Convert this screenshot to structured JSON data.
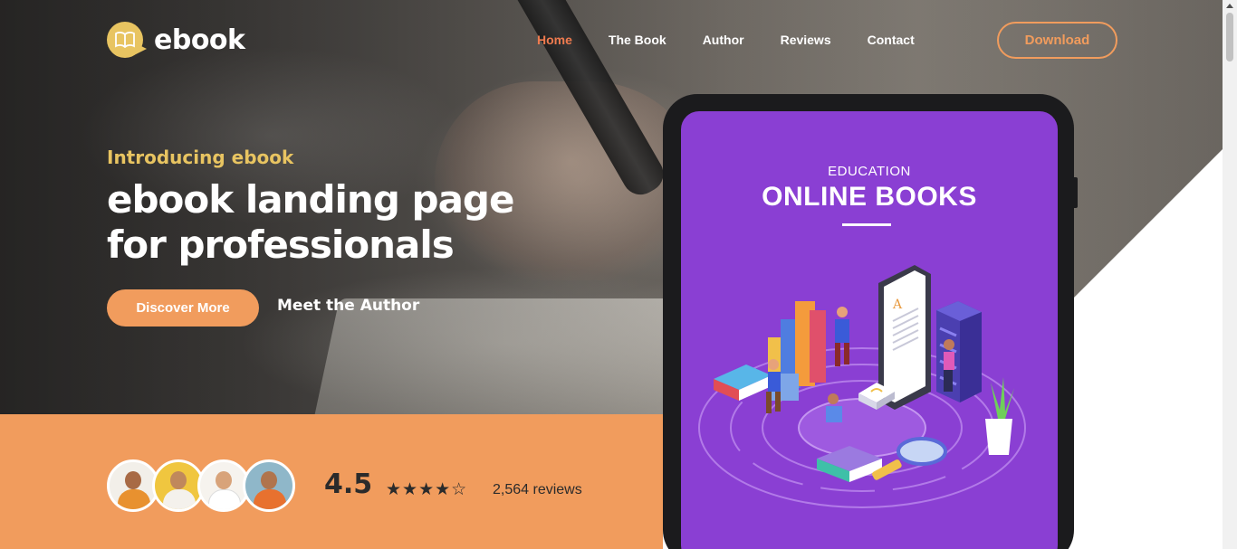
{
  "brand": {
    "name": "ebook",
    "icon": "open-book-icon",
    "accent": "#e8c461"
  },
  "nav": {
    "items": [
      {
        "label": "Home",
        "active": true
      },
      {
        "label": "The Book",
        "active": false
      },
      {
        "label": "Author",
        "active": false
      },
      {
        "label": "Reviews",
        "active": false
      },
      {
        "label": "Contact",
        "active": false
      }
    ],
    "cta_label": "Download"
  },
  "hero": {
    "eyebrow": "Introducing ebook",
    "headline_line1": "ebook landing page",
    "headline_line2": "for professionals",
    "primary_button": "Discover More",
    "secondary_link": "Meet the Author"
  },
  "reviews": {
    "rating": "4.5",
    "stars": "★★★★☆",
    "stars_value": 4.5,
    "count_text": "2,564 reviews"
  },
  "tablet_screen": {
    "kicker": "EDUCATION",
    "title": "ONLINE BOOKS"
  },
  "colors": {
    "orange": "#f19c5d",
    "nav_active": "#ef7b4f",
    "purple": "#8a3fd3",
    "gold": "#e8c461"
  }
}
